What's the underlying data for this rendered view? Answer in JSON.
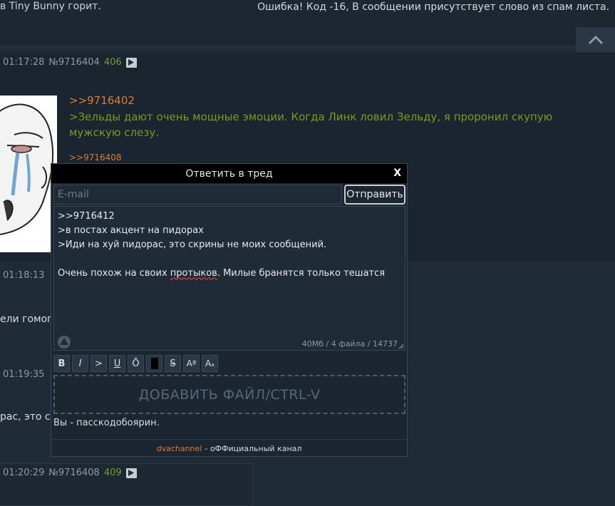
{
  "top": {
    "left_text": "в Tiny Bunny горит.",
    "error_text": "Ошибка! Код -16, В сообщении присутствует слово из спам листа."
  },
  "posts": [
    {
      "time": "01:17:28",
      "number": "№9716404",
      "count": "406",
      "reply_link": ">>9716402",
      "quote": ">Зельды дают очень мощные эмоции. Когда Линк ловил Зельду, я проронил скупую мужскую слезу.",
      "backlink": ">>9716408"
    },
    {
      "time": "01:18:13",
      "text": "ели гомоге"
    },
    {
      "time": "01:19:35",
      "text": "рас, это с"
    },
    {
      "time": "01:20:29",
      "number": "№9716408",
      "count": "409"
    }
  ],
  "form": {
    "title": "Ответить в тред",
    "close": "X",
    "email_placeholder": "E-mail",
    "send_label": "Отправить",
    "message_lines": [
      ">>9716412",
      ">в постах акцент на пидорах",
      ">Иди на хуй пидорас, это скрины не моих сообщений."
    ],
    "message_last_before": "Очень похож на своих ",
    "message_last_misspelled": "протыков",
    "message_last_after": ". Милые бранятся только тешатся",
    "limits": "40Мб / 4 файла / 14737",
    "markup_buttons": [
      "B",
      "I",
      ">",
      "U",
      "Ō",
      "",
      "S",
      "Aª",
      "Aₐ"
    ],
    "dropzone_label": "ДОБАВИТЬ ФАЙЛ/CTRL-V",
    "status_line": "Вы - пасскодобоярин.",
    "footer_link": "dvachannel",
    "footer_text": "- оФФициальный канал"
  },
  "colors": {
    "background": "#1f2b36",
    "accent_link": "#e07a2e",
    "greentext": "#789922",
    "reply_count": "#6fa02e"
  }
}
